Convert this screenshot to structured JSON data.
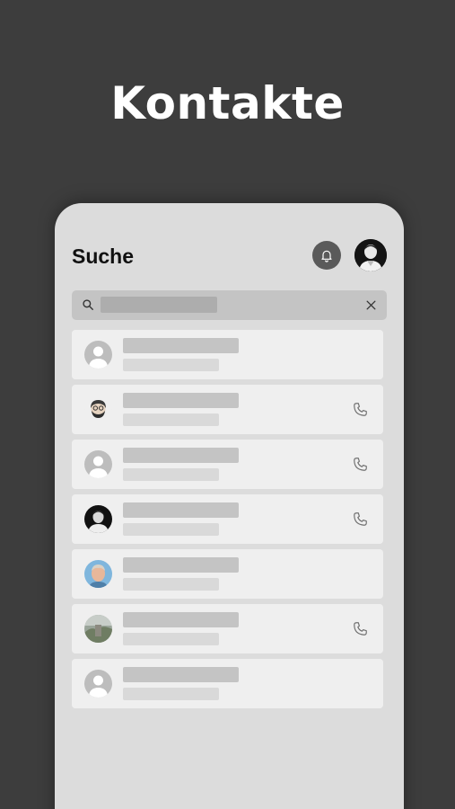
{
  "hero": {
    "title": "Kontakte"
  },
  "app": {
    "title": "Suche"
  },
  "icons": {
    "bell": "bell-icon",
    "search": "search-icon",
    "clear": "close-icon",
    "call": "phone-icon",
    "default_avatar": "person-icon"
  },
  "search": {
    "value": "",
    "placeholder": ""
  },
  "contacts": [
    {
      "avatar": "default",
      "has_call": false
    },
    {
      "avatar": "bearded-man",
      "has_call": true
    },
    {
      "avatar": "default",
      "has_call": true
    },
    {
      "avatar": "dark-portrait",
      "has_call": true
    },
    {
      "avatar": "man-blue-background",
      "has_call": false
    },
    {
      "avatar": "landscape-photo",
      "has_call": true
    },
    {
      "avatar": "default",
      "has_call": false
    }
  ],
  "colors": {
    "background": "#3d3d3d",
    "phone": "#dcdcdc",
    "row": "#efefef",
    "placeholder": "#c4c4c4",
    "bell_button": "#5a5a5a"
  }
}
